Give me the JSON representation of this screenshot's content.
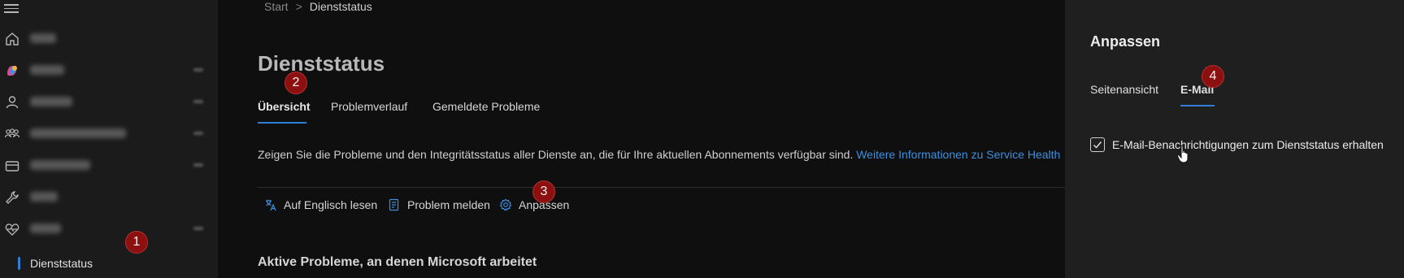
{
  "breadcrumb": {
    "home": "Start",
    "separator": ">",
    "current": "Dienststatus"
  },
  "sidebar": {
    "selected_subitem": "Dienststatus",
    "items": [
      {
        "icon": "home-icon",
        "label_blurred": true
      },
      {
        "icon": "copilot-icon",
        "label_blurred": true,
        "expandable": true
      },
      {
        "icon": "user-icon",
        "label_blurred": true,
        "expandable": true
      },
      {
        "icon": "groups-icon",
        "label_blurred": true,
        "expandable": true
      },
      {
        "icon": "billing-icon",
        "label_blurred": true,
        "expandable": true
      },
      {
        "icon": "wrench-icon",
        "label_blurred": true
      },
      {
        "icon": "health-icon",
        "label_blurred": true,
        "expanded": true
      }
    ]
  },
  "main": {
    "title": "Dienststatus",
    "tabs": [
      {
        "label": "Übersicht",
        "active": true
      },
      {
        "label": "Problemverlauf",
        "active": false
      },
      {
        "label": "Gemeldete Probleme",
        "active": false
      }
    ],
    "description": "Zeigen Sie die Probleme und den Integritätsstatus aller Dienste an, die für Ihre aktuellen Abonnements verfügbar sind.",
    "description_link": "Weitere Informationen zu Service Health",
    "commands": [
      {
        "label": "Auf Englisch lesen",
        "icon": "translate-icon"
      },
      {
        "label": "Problem melden",
        "icon": "report-icon"
      },
      {
        "label": "Anpassen",
        "icon": "gear-icon"
      }
    ],
    "section_title": "Aktive Probleme, an denen Microsoft arbeitet"
  },
  "panel": {
    "title": "Anpassen",
    "tabs": [
      {
        "label": "Seitenansicht",
        "active": false
      },
      {
        "label": "E-Mail",
        "active": true
      }
    ],
    "checkbox_label": "E-Mail-Benachrichtigungen zum Dienststatus erhalten",
    "checkbox_checked": true
  },
  "callouts": [
    "1",
    "2",
    "3",
    "4"
  ],
  "colors": {
    "accent": "#2f7fd7",
    "callout": "#8c1010",
    "panel_bg": "#1f1f1f",
    "sidebar_bg": "#1b1b1b"
  }
}
